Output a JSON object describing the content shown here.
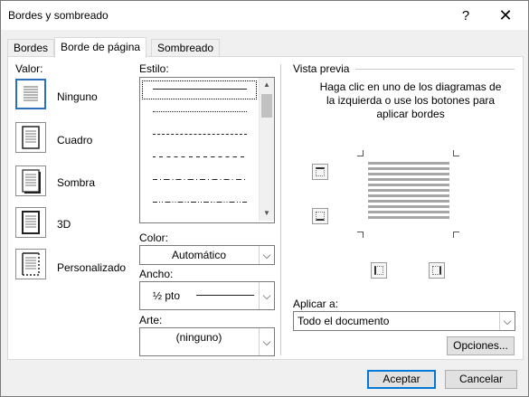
{
  "window": {
    "title": "Bordes y sombreado",
    "help": "?",
    "close": "✕"
  },
  "tabs": [
    {
      "label": "Bordes"
    },
    {
      "label": "Borde de página"
    },
    {
      "label": "Sombreado"
    }
  ],
  "setting": {
    "label": "Valor:",
    "items": [
      {
        "label": "Ninguno"
      },
      {
        "label": "Cuadro"
      },
      {
        "label": "Sombra"
      },
      {
        "label": "3D"
      },
      {
        "label": "Personalizado"
      }
    ]
  },
  "style": {
    "label": "Estilo:"
  },
  "color": {
    "label": "Color:",
    "value": "Automático"
  },
  "width": {
    "label": "Ancho:",
    "value": "½ pto"
  },
  "art": {
    "label": "Arte:",
    "value": "(ninguno)"
  },
  "preview": {
    "label": "Vista previa",
    "hint": "Haga clic en uno de los diagramas de la izquierda o use los botones para aplicar bordes"
  },
  "apply": {
    "label": "Aplicar a:",
    "value": "Todo el documento"
  },
  "buttons": {
    "options": "Opciones...",
    "accept": "Aceptar",
    "cancel": "Cancelar"
  }
}
